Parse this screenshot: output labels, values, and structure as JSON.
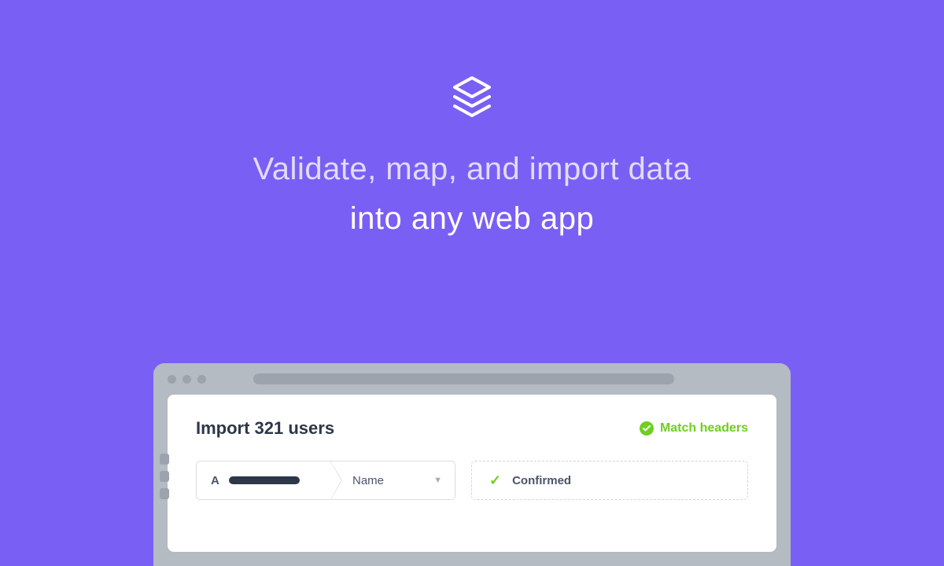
{
  "headline": {
    "line1": "Validate, map, and import data",
    "line2": "into any web app"
  },
  "card": {
    "title": "Import 321 users",
    "match_headers_label": "Match headers",
    "mapping": {
      "column_letter": "A",
      "field_name": "Name",
      "status_label": "Confirmed"
    }
  },
  "colors": {
    "background": "#7A5FF5",
    "accent_green": "#6FCF1F"
  }
}
